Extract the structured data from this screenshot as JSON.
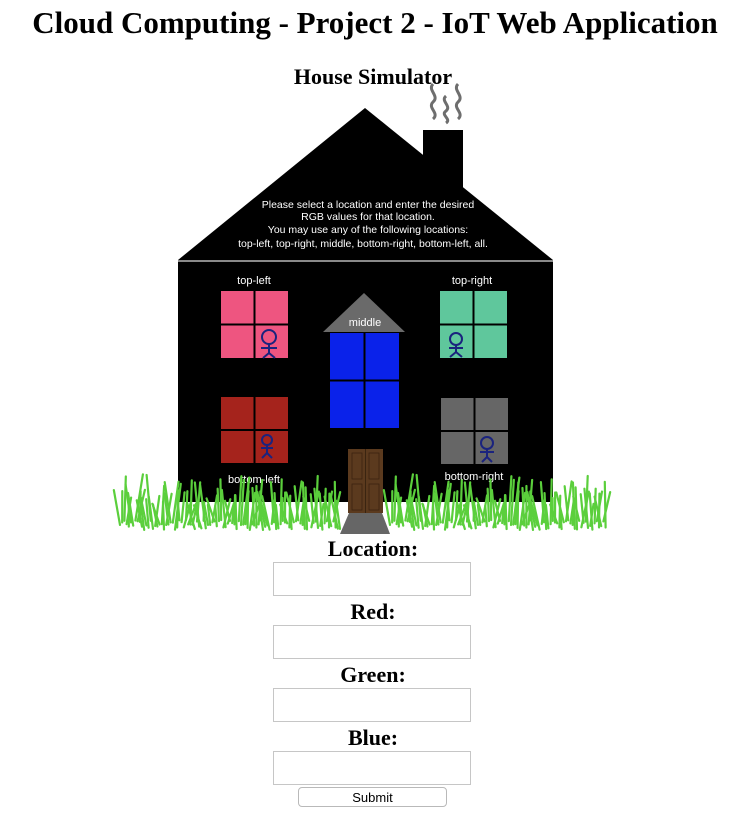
{
  "page": {
    "title": "Cloud Computing - Project 2 - IoT Web Application"
  },
  "simulator": {
    "heading": "House Simulator",
    "instructions": [
      "Please select a location and enter the desired",
      "RGB values for that location.",
      "You may use any of the following locations:",
      "top-left, top-right, middle, bottom-right, bottom-left, all."
    ],
    "windows": {
      "top_left": {
        "label": "top-left",
        "color": "#ee5580"
      },
      "top_right": {
        "label": "top-right",
        "color": "#5fc79c"
      },
      "middle": {
        "label": "middle",
        "color": "#0a22ea"
      },
      "bottom_left": {
        "label": "bottom-left",
        "color": "#a5231c"
      },
      "bottom_right": {
        "label": "bottom-right",
        "color": "#666666"
      }
    },
    "colors": {
      "house": "#000000",
      "grass": "#5bcf3c",
      "door": "#5b3a1e",
      "path": "#666666",
      "figure": "#1a237e"
    }
  },
  "form": {
    "location_label": "Location:",
    "red_label": "Red:",
    "green_label": "Green:",
    "blue_label": "Blue:",
    "location_value": "",
    "red_value": "",
    "green_value": "",
    "blue_value": "",
    "submit_label": "Submit"
  }
}
